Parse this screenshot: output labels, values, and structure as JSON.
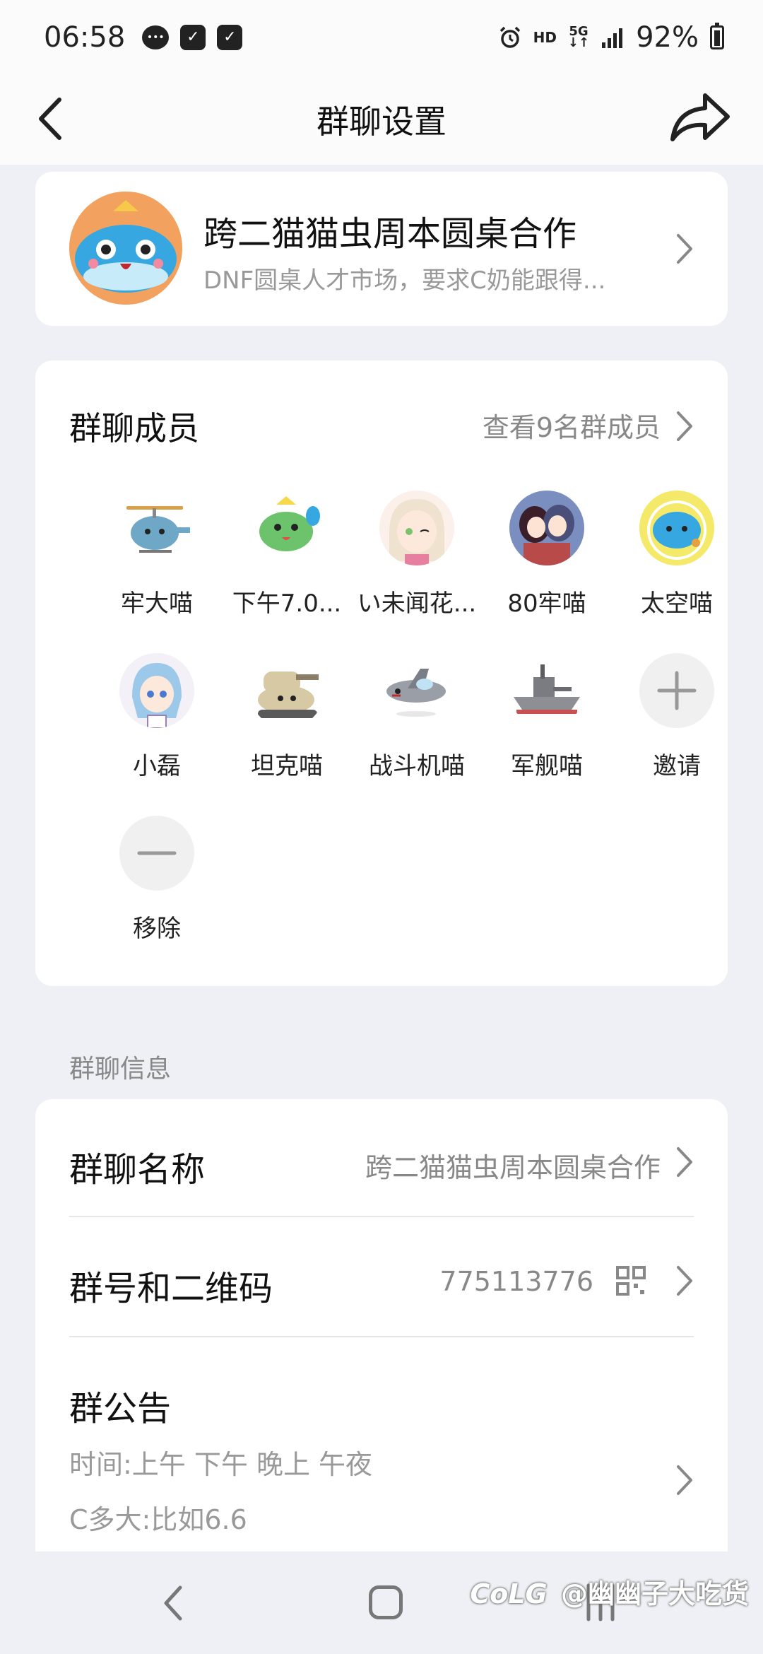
{
  "status_bar": {
    "time": "06:58",
    "hd": "HD",
    "network": "5G",
    "battery": "92%",
    "icons": [
      "chat-bubble-icon",
      "vpn-icon",
      "checkbox-icon",
      "alarm-icon",
      "signal-icon",
      "battery-icon"
    ]
  },
  "nav": {
    "title": "群聊设置",
    "back_icon": "back-arrow-icon",
    "share_icon": "share-icon"
  },
  "group": {
    "name": "跨二猫猫虫周本圆桌合作",
    "description": "DNF圆桌人才市场，要求C奶能跟得..."
  },
  "members": {
    "title": "群聊成员",
    "view_all": "查看9名群成员",
    "list": [
      {
        "name": "牢大喵",
        "color": "#6fa7c6"
      },
      {
        "name": "下午7.0...",
        "color": "#6cc36b"
      },
      {
        "name": "い未闻花...",
        "color": "#f0e4d8"
      },
      {
        "name": "80牢喵",
        "color": "#b94a4a"
      },
      {
        "name": "太空喵",
        "color": "#f5e96a"
      },
      {
        "name": "小磊",
        "color": "#9cc8ea"
      },
      {
        "name": "坦克喵",
        "color": "#d8c9a5"
      },
      {
        "name": "战斗机喵",
        "color": "#9a9ea6"
      },
      {
        "name": "军舰喵",
        "color": "#8d8f95"
      }
    ],
    "invite_label": "邀请",
    "remove_label": "移除"
  },
  "info": {
    "section_label": "群聊信息",
    "name_row": {
      "title": "群聊名称",
      "value": "跨二猫猫虫周本圆桌合作"
    },
    "number_row": {
      "title": "群号和二维码",
      "value": "775113776"
    },
    "notice_row": {
      "title": "群公告",
      "line1": "时间:上午 下午 晚上 午夜",
      "line2": "C多大:比如6.6"
    }
  },
  "watermark": {
    "logo": "CoLG",
    "text": "@幽幽子大吃货"
  }
}
